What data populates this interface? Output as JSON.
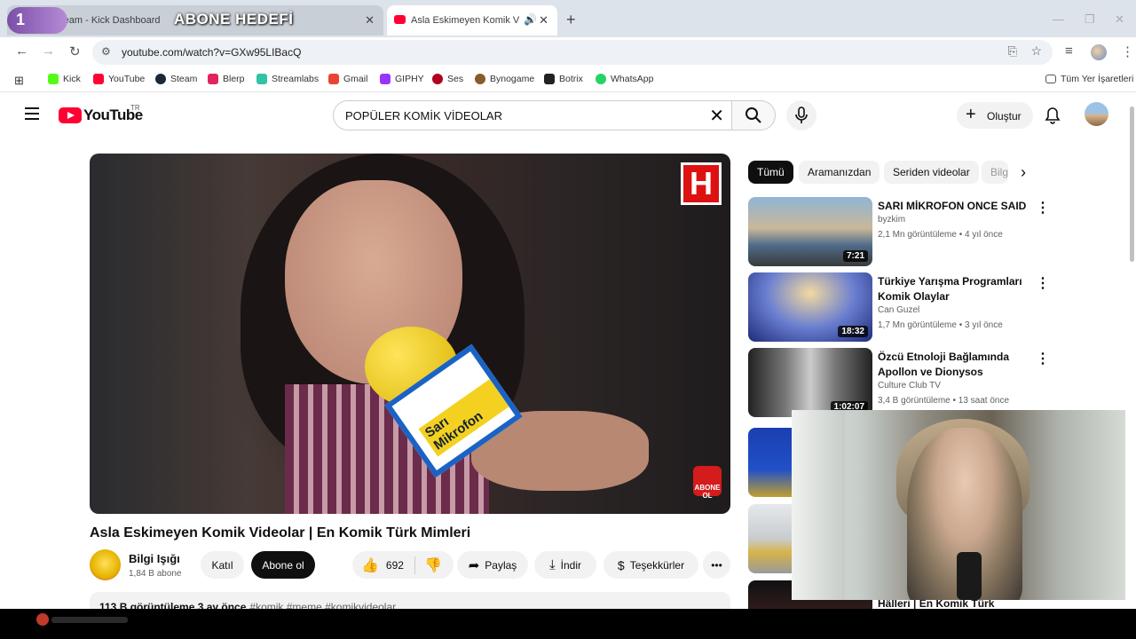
{
  "browser": {
    "tabs": [
      {
        "label": "ream - Kick Dashboard"
      },
      {
        "label": "Asla Eskimeyen Komik Video"
      }
    ],
    "overlay_badge": "1",
    "overlay_goal": "ABONE HEDEFİ",
    "url": "youtube.com/watch?v=GXw95LIBacQ",
    "bookmarks": [
      {
        "label": "Kick",
        "color": "#53fc18"
      },
      {
        "label": "YouTube",
        "color": "#ff0033"
      },
      {
        "label": "Steam",
        "color": "#1b2838"
      },
      {
        "label": "Blerp",
        "color": "#e0245e"
      },
      {
        "label": "Streamlabs",
        "color": "#31c3a2"
      },
      {
        "label": "Gmail",
        "color": "#ea4335"
      },
      {
        "label": "GIPHY",
        "color": "#9933ff"
      },
      {
        "label": "Ses",
        "color": "#b00020"
      },
      {
        "label": "Bynogame",
        "color": "#8a5a2b"
      },
      {
        "label": "Botrix",
        "color": "#222222"
      },
      {
        "label": "WhatsApp",
        "color": "#25d366"
      }
    ],
    "all_bookmarks": "Tüm Yer İşaretleri"
  },
  "yt": {
    "logo": "YouTube",
    "region": "TR",
    "search_value": "POPÜLER KOMİK VİDEOLAR",
    "create": "Oluştur"
  },
  "video": {
    "title": "Asla Eskimeyen Komik Videolar | En Komik Türk Mimleri",
    "channel": "Bilgi Işığı",
    "subs": "1,84 B abone",
    "join": "Katıl",
    "subscribe": "Abone ol",
    "likes": "692",
    "share": "Paylaş",
    "download": "İndir",
    "thanks": "Teşekkürler",
    "mic_text": "Sarı Mikrofon",
    "channel_logo": "H",
    "abone_logo": "ABONE OL",
    "views_date": "113 B görüntüleme  3 ay önce",
    "tags": "#komik #meme #komikvideolar"
  },
  "chips": [
    "Tümü",
    "Aramanızdan",
    "Seriden videolar",
    "Bilgi"
  ],
  "recs": [
    {
      "title": "SARI MİKROFON ONCE SAID",
      "channel": "byzkim",
      "meta": "2,1 Mn görüntüleme • 4 yıl önce",
      "duration": "7:21"
    },
    {
      "title": "Türkiye Yarışma Programları Komik Olaylar",
      "channel": "Can Guzel",
      "meta": "1,7 Mn görüntüleme • 3 yıl önce",
      "duration": "18:32"
    },
    {
      "title": "Özcü Etnoloji Bağlamında Apollon ve Dionysos",
      "channel": "Culture Club TV",
      "meta": "3,4 B görüntüleme • 13 saat önce",
      "duration": "1:02:07"
    },
    {
      "title": "",
      "channel": "",
      "meta": "",
      "duration": ""
    },
    {
      "title": "",
      "channel": "",
      "meta": "",
      "duration": ""
    },
    {
      "title": "Hâlleri | En Komik Türk Mimler...",
      "channel": "",
      "meta": "",
      "duration": ""
    }
  ],
  "colors": {
    "accent": "#ff0033",
    "chip_active": "#0f0f0f"
  }
}
